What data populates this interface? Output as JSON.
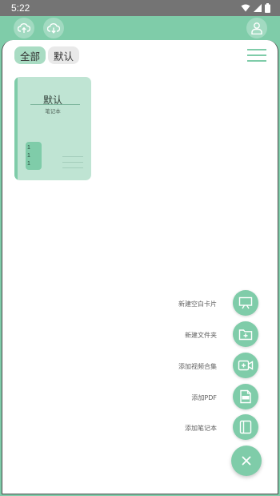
{
  "status_bar": {
    "time": "5:22",
    "icons": [
      "wifi-icon",
      "signal-icon",
      "battery-icon"
    ]
  },
  "app_bar": {
    "icons": [
      "cloud-upload-icon",
      "cloud-download-icon",
      "user-icon"
    ]
  },
  "tabs": [
    {
      "label": "全部",
      "active": true
    },
    {
      "label": "默认",
      "active": false
    }
  ],
  "notebook": {
    "title": "默认",
    "subtitle": "笔记本",
    "counts": [
      "1",
      "1",
      "1"
    ]
  },
  "fab_menu": {
    "items": [
      {
        "label": "新建空白卡片",
        "icon": "presentation-board-icon"
      },
      {
        "label": "新建文件夹",
        "icon": "folder-add-icon"
      },
      {
        "label": "添加视频合集",
        "icon": "video-add-icon"
      },
      {
        "label": "添加PDF",
        "icon": "pdf-file-icon"
      },
      {
        "label": "添加笔记本",
        "icon": "notebook-icon"
      }
    ],
    "close_icon": "close-icon"
  },
  "colors": {
    "accent": "#7fcca9",
    "accent_light": "#bfe4d3",
    "status_bar": "#747474"
  }
}
